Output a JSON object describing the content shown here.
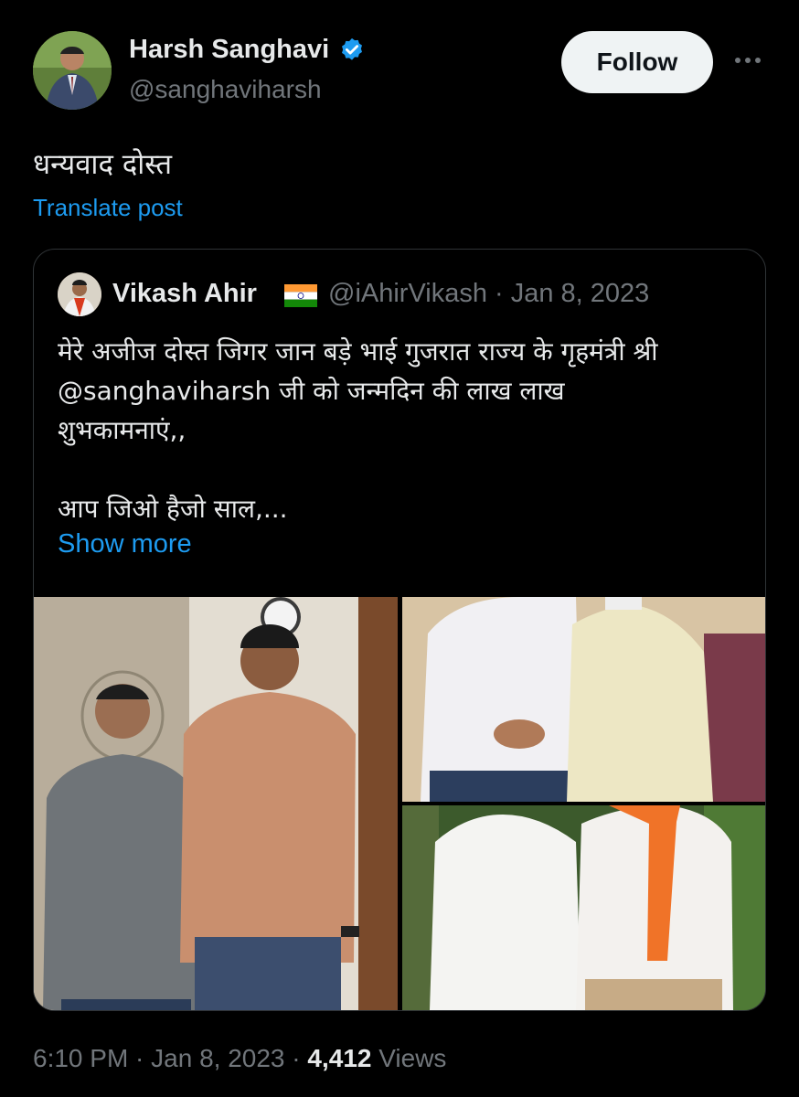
{
  "author": {
    "name": "Harsh Sanghavi",
    "handle": "@sanghaviharsh",
    "verified_icon": "verified-badge-icon",
    "follow_label": "Follow"
  },
  "post": {
    "text": "धन्यवाद दोस्त",
    "translate_label": "Translate post"
  },
  "quote": {
    "name": "Vikash Ahir",
    "flag_icon": "india-flag-icon",
    "handle_date": "@iAhirVikash · Jan 8, 2023",
    "body": "मेरे अजीज दोस्त जिगर जान बड़े भाई गुजरात राज्य के गृहमंत्री श्री\n@sanghaviharsh जी को जन्मदिन की लाख लाख\nशुभकामनाएं,,\n\nआप जिओ हैजो साल,...",
    "show_more_label": "Show more"
  },
  "footer": {
    "time_date": "6:10 PM · Jan 8, 2023 · ",
    "views_count": "4,412",
    "views_label": " Views"
  },
  "colors": {
    "background": "#000000",
    "link": "#1d9bf0",
    "muted": "#71767b",
    "verified": "#1d9bf0"
  }
}
